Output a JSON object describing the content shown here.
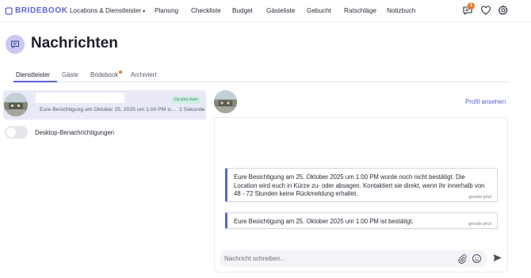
{
  "brand": {
    "name": "BRIDEBOOK",
    "color": "#5b63d8"
  },
  "nav": {
    "items": [
      {
        "label": "Locations & Dienstleister",
        "dropdown": true
      },
      {
        "label": "Planung"
      },
      {
        "label": "Checkliste"
      },
      {
        "label": "Budget"
      },
      {
        "label": "Gästeliste"
      },
      {
        "label": "Gebucht"
      },
      {
        "label": "Ratschläge"
      },
      {
        "label": "Notizbuch"
      }
    ],
    "caret": "▾",
    "messages_badge": "1",
    "icons": [
      "chat-icon",
      "heart-icon",
      "gear-icon"
    ]
  },
  "page": {
    "title": "Nachrichten",
    "icon": "chat-bubble-icon"
  },
  "tabs": [
    {
      "label": "Dienstleister",
      "active": true
    },
    {
      "label": "Gäste",
      "active": false
    },
    {
      "label": "Bridebook",
      "active": false,
      "has_dot": true
    },
    {
      "label": "Archiviert",
      "active": false
    }
  ],
  "conversation": {
    "badge": "Du bist dran",
    "preview": "Eure Besichtigung am Oktober 25, 2025 um 1:00 PM is...",
    "time": "1 Sekunde"
  },
  "notifications": {
    "label": "Desktop-Benachrichtigungen",
    "enabled": false
  },
  "chat": {
    "profile_link": "Profil ansehen",
    "messages": [
      {
        "text": "Eure Besichtigung am 25. Oktober 2025 um 1:00 PM wurde noch nicht bestätigt. Die Location wird euch in Kürze zu- oder absagen. Kontaktiert sie direkt, wenn ihr innerhalb von 48 - 72 Stunden keine Rückmeldung erhaltet.",
        "time": "gerade jetzt"
      },
      {
        "text": "Eure Besichtigung am 25. Oktober 2025 um 1:00 PM ist bestätigt.",
        "time": "gerade jetzt"
      }
    ],
    "composer_placeholder": "Nachricht schreiben...",
    "composer_icons": [
      "paperclip-icon",
      "emoji-icon",
      "send-icon"
    ]
  },
  "colors": {
    "accent": "#5b63d8",
    "badge_orange": "#e8772e",
    "active_bg": "#e9e9f7"
  }
}
